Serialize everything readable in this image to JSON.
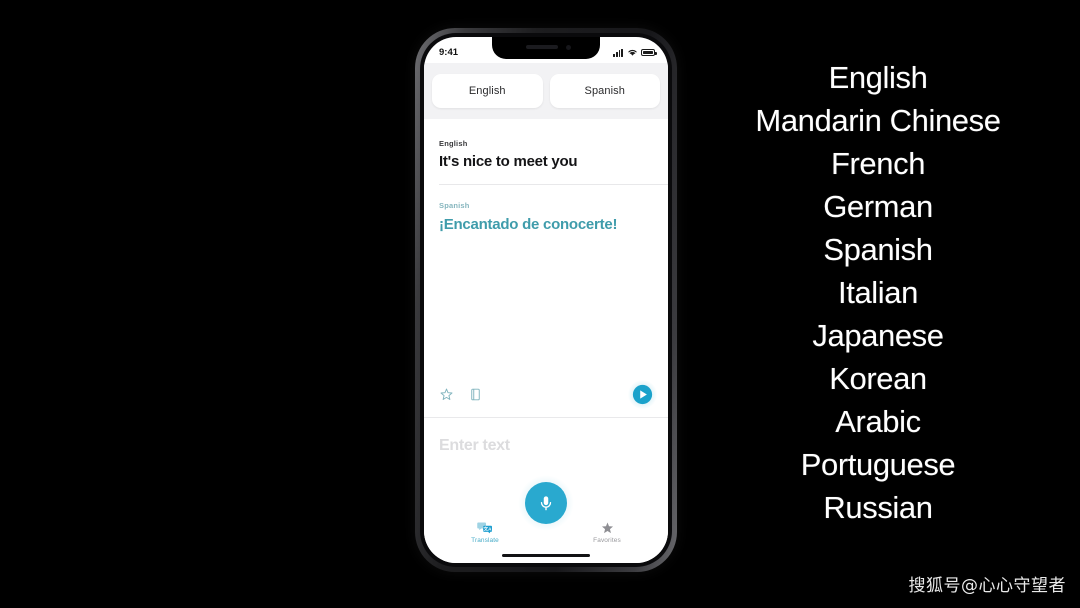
{
  "phone": {
    "status_bar": {
      "time": "9:41",
      "signal_icon": "cellular-signal-icon",
      "wifi_icon": "wifi-icon",
      "battery_icon": "battery-icon"
    },
    "language_selector": {
      "source_language": "English",
      "target_language": "Spanish"
    },
    "translation_card": {
      "source_label": "English",
      "source_text": "It's nice to meet you",
      "target_label": "Spanish",
      "target_text": "¡Encantado de conocerte!",
      "actions": {
        "favorite_icon": "star-icon",
        "dictionary_icon": "book-icon",
        "play_icon": "play-circle-icon"
      }
    },
    "input": {
      "placeholder": "Enter text",
      "mic_icon": "microphone-icon"
    },
    "tab_bar": [
      {
        "label": "Translate",
        "icon": "translate-bubbles-icon",
        "active": true
      },
      {
        "label": "Favorites",
        "icon": "star-icon",
        "active": false
      }
    ]
  },
  "language_list": {
    "items": [
      "English",
      "Mandarin Chinese",
      "French",
      "German",
      "Spanish",
      "Italian",
      "Japanese",
      "Korean",
      "Arabic",
      "Portuguese",
      "Russian"
    ]
  },
  "watermark": {
    "text": "搜狐号@心心守望者"
  },
  "colors": {
    "background": "#000000",
    "accent_cyan": "#29a9cf",
    "translation_teal": "#3f9cab",
    "screen_white": "#ffffff",
    "pill_background": "#f2f2f4"
  }
}
